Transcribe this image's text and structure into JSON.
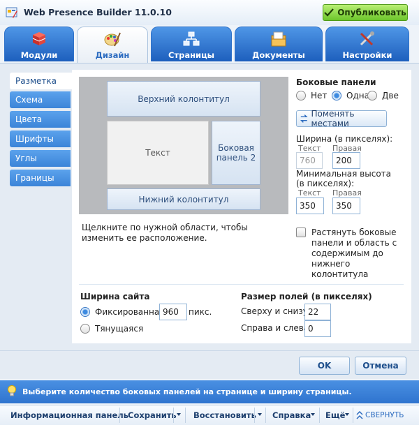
{
  "app": {
    "title": "Web Presence Builder 11.0.10",
    "publish_label": "Опубликовать"
  },
  "tabs": [
    {
      "label": "Модули",
      "icon": "modules-icon"
    },
    {
      "label": "Дизайн",
      "icon": "design-icon",
      "active": true
    },
    {
      "label": "Страницы",
      "icon": "pages-icon"
    },
    {
      "label": "Документы",
      "icon": "documents-icon"
    },
    {
      "label": "Настройки",
      "icon": "settings-icon"
    }
  ],
  "sidebar": {
    "items": [
      {
        "label": "Разметка",
        "active": true
      },
      {
        "label": "Схема"
      },
      {
        "label": "Цвета"
      },
      {
        "label": "Шрифты"
      },
      {
        "label": "Углы"
      },
      {
        "label": "Границы"
      }
    ]
  },
  "layout": {
    "header": "Верхний колонтитул",
    "text": "Текст",
    "sidebar": "Боковая панель 2",
    "footer": "Нижний колонтитул",
    "hint": "Щелкните по нужной области, чтобы изменить ее расположение."
  },
  "side_panels": {
    "title": "Боковые панели",
    "options": [
      "Нет",
      "Одна",
      "Две"
    ],
    "selected": "Одна",
    "swap_label": "Поменять местами",
    "width_label": "Ширина (в пикселях):",
    "text_label": "Текст",
    "right_label": "Правая",
    "width_text": "760",
    "width_right": "200",
    "min_height_label": "Минимальная высота (в пикселях):",
    "min_height_text": "350",
    "min_height_right": "350",
    "stretch_label": "Растянуть боковые панели и область с содержимым до нижнего колонтитула"
  },
  "site_width": {
    "title": "Ширина сайта",
    "fixed_label": "Фиксированная",
    "fixed_value": "960",
    "unit": "пикс.",
    "fluid_label": "Тянущаяся"
  },
  "margins": {
    "title": "Размер полей (в пикселях)",
    "top_bottom_label": "Сверху и снизу",
    "top_bottom_value": "22",
    "left_right_label": "Справа и слева",
    "left_right_value": "0"
  },
  "dialog": {
    "ok_label": "OK",
    "cancel_label": "Отмена"
  },
  "infobar": {
    "text": "Выберите количество боковых панелей на странице и ширину страницы."
  },
  "bottombar": {
    "info_panel": "Информационная панель",
    "save": "Сохранить",
    "restore": "Восстановить",
    "help": "Справка",
    "more": "Ещё",
    "collapse": "СВЕРНУТЬ"
  },
  "colors": {
    "accent": "#3b84d8",
    "publish": "#6cc62b",
    "infobar": "#2f74cf"
  }
}
